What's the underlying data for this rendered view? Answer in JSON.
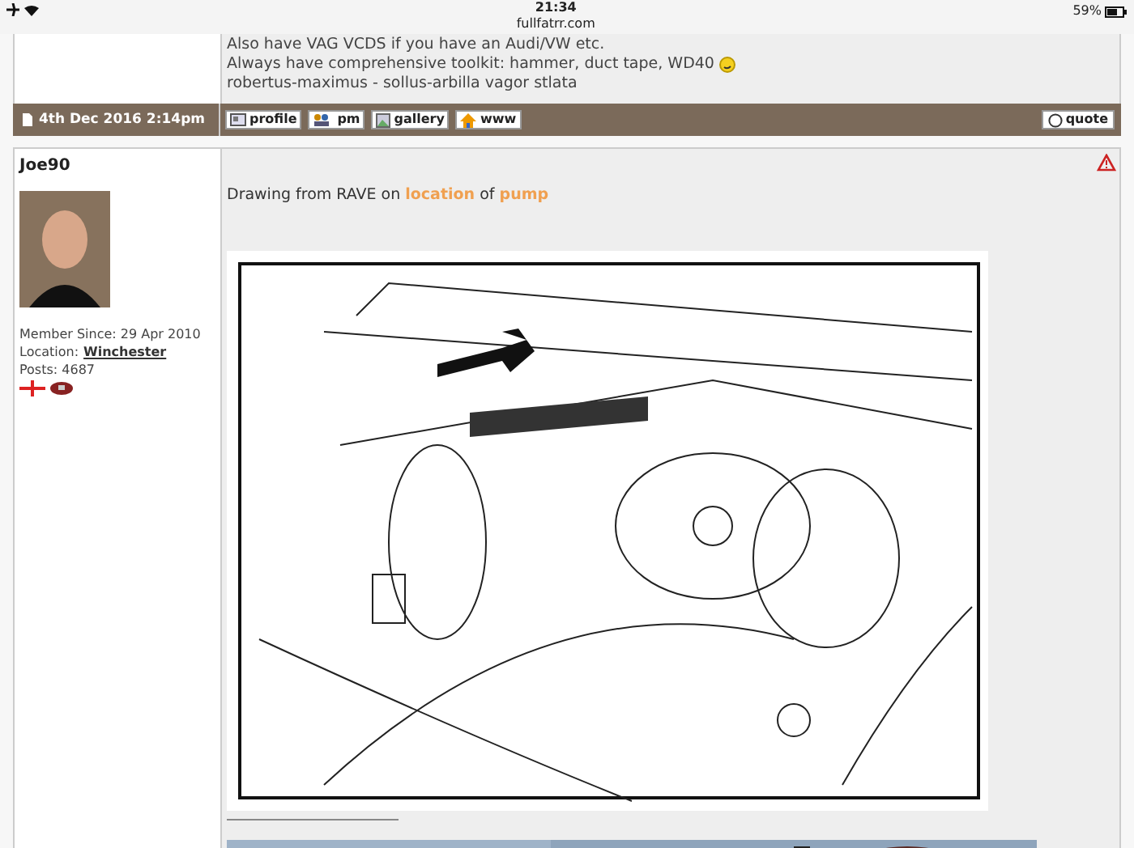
{
  "status_bar": {
    "time": "21:34",
    "url": "fullfatrr.com",
    "battery": "59%"
  },
  "previous_post": {
    "signature_lines": [
      "Also have VAG VCDS if you have an Audi/VW etc.",
      "Always have comprehensive toolkit: hammer, duct tape, WD40",
      "robertus-maximus - sollus-arbilla vagor stlata"
    ]
  },
  "post_bar": {
    "date": "4th Dec 2016 2:14pm",
    "buttons": [
      {
        "label": "profile",
        "kind": "profile"
      },
      {
        "label": "pm",
        "kind": "pm"
      },
      {
        "label": "gallery",
        "kind": "gallery"
      },
      {
        "label": "www",
        "kind": "www"
      }
    ],
    "quote": "quote"
  },
  "post": {
    "author": "Joe90",
    "member_since": "Member Since: 29 Apr 2010",
    "location_label": "Location:",
    "location": "Winchester",
    "posts": "Posts: 4687",
    "text_parts": [
      {
        "text": "Drawing from RAVE on ",
        "link": false
      },
      {
        "text": "location",
        "link": true
      },
      {
        "text": " of ",
        "link": false
      },
      {
        "text": "pump",
        "link": true
      }
    ]
  }
}
